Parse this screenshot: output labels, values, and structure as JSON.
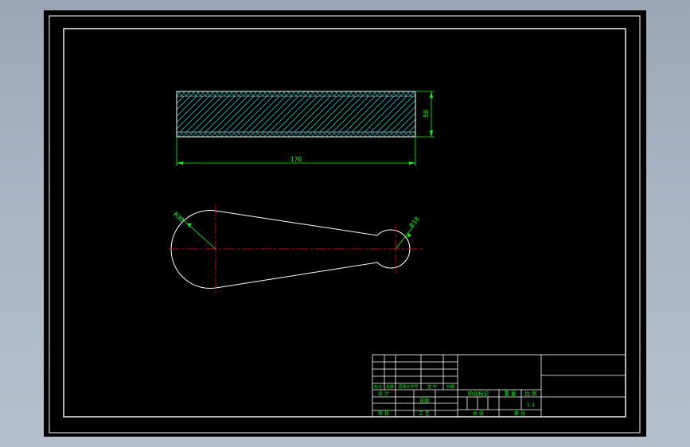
{
  "colors": {
    "background": "#000000",
    "frame": "#ffffff",
    "dimension": "#00ff00",
    "hatch": "#00c8c8",
    "centerline": "#ff0000",
    "outline": "#ffffff"
  },
  "top_view": {
    "length_dimension": "170",
    "thickness_dimension": "58"
  },
  "front_view": {
    "large_radius_label": "R32",
    "small_radius_label": "R18"
  },
  "title_block": {
    "cell_labels": [
      "标记",
      "处数",
      "更改文件号",
      "签 字",
      "日期"
    ],
    "row_label_1": "设 计",
    "row_label_2": "审 核",
    "row_label_3": "工 艺",
    "date_label": "日期",
    "stage_label": "阶段标记",
    "weight_label": "重 量",
    "scale_label": "比 例",
    "scale_value": "1:1",
    "sheets_label": "共    张",
    "sheet_label": "第    张"
  }
}
